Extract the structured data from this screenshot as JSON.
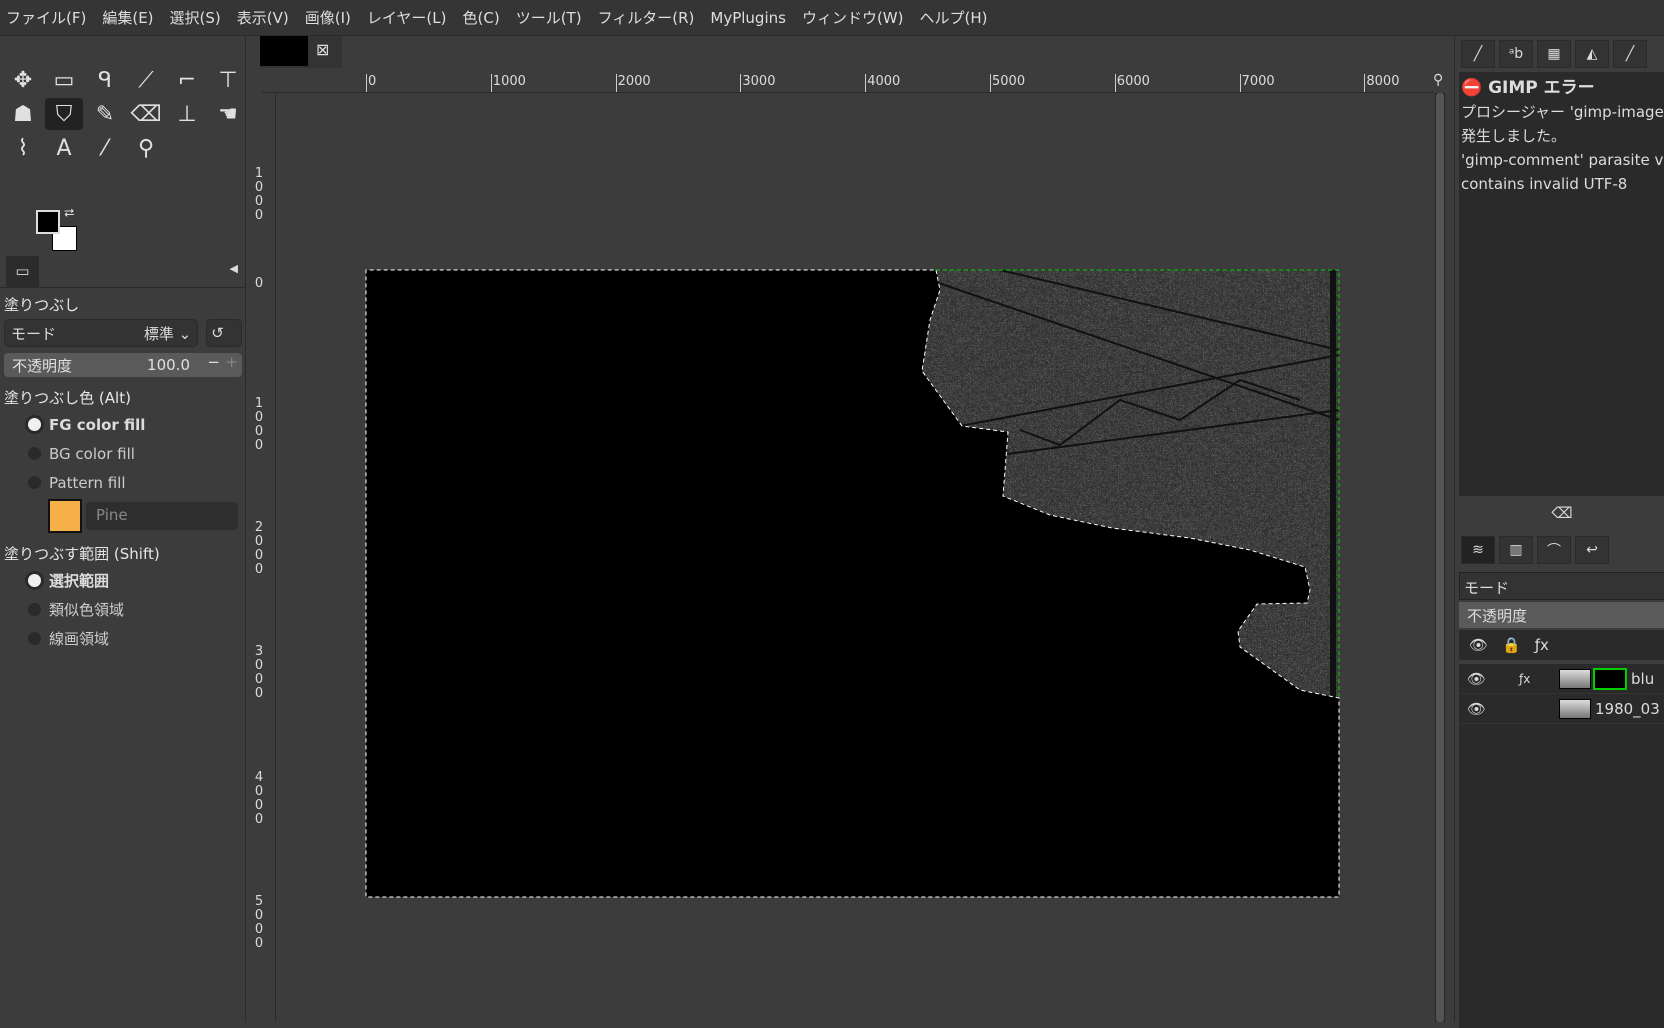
{
  "menu": [
    "ファイル(F)",
    "編集(E)",
    "選択(S)",
    "表示(V)",
    "画像(I)",
    "レイヤー(L)",
    "色(C)",
    "ツール(T)",
    "フィルター(R)",
    "MyPlugins",
    "ウィンドウ(W)",
    "ヘルプ(H)"
  ],
  "tools": [
    {
      "name": "move-tool-icon",
      "glyph": "✥"
    },
    {
      "name": "rect-select-icon",
      "glyph": "▭"
    },
    {
      "name": "lasso-icon",
      "glyph": "ᑫ"
    },
    {
      "name": "fuzzy-select-icon",
      "glyph": "⟋"
    },
    {
      "name": "crop-icon",
      "glyph": "⌐"
    },
    {
      "name": "transform-icon",
      "glyph": "⊤"
    },
    {
      "name": "warp-icon",
      "glyph": "☗"
    },
    {
      "name": "bucket-fill-icon",
      "glyph": "⛉",
      "active": true
    },
    {
      "name": "paintbrush-icon",
      "glyph": "✎"
    },
    {
      "name": "eraser-icon",
      "glyph": "⌫"
    },
    {
      "name": "clone-icon",
      "glyph": "⊥"
    },
    {
      "name": "smudge-icon",
      "glyph": "☚"
    },
    {
      "name": "path-icon",
      "glyph": "⌇"
    },
    {
      "name": "text-icon",
      "glyph": "A"
    },
    {
      "name": "color-picker-icon",
      "glyph": "⁄"
    },
    {
      "name": "zoom-icon",
      "glyph": "⚲"
    }
  ],
  "colors": {
    "fg": "#000000",
    "bg": "#ffffff",
    "pattern": "#f5b04a",
    "selection_green": "#00cc00"
  },
  "options": {
    "title": "塗りつぶし",
    "mode_label": "モード",
    "mode_value": "標準",
    "opacity_label": "不透明度",
    "opacity_value": "100.0",
    "fill_type_label": "塗りつぶし色 (Alt)",
    "fill_types": [
      {
        "label": "FG color fill",
        "selected": true
      },
      {
        "label": "BG color fill",
        "selected": false
      },
      {
        "label": "Pattern fill",
        "selected": false
      }
    ],
    "pattern_name": "Pine",
    "area_label": "塗りつぶす範囲 (Shift)",
    "areas": [
      {
        "label": "選択範囲",
        "selected": true
      },
      {
        "label": "類似色領域",
        "selected": false
      },
      {
        "label": "線画領域",
        "selected": false
      }
    ]
  },
  "ruler": {
    "h": [
      "0",
      "1000",
      "2000",
      "3000",
      "4000",
      "5000",
      "6000",
      "7000",
      "8000"
    ],
    "v": [
      "1000",
      "0",
      "1000",
      "2000",
      "3000",
      "4000",
      "5000"
    ]
  },
  "error": {
    "title": "GIMP エラー",
    "lines": [
      "プロシージャー 'gimp-image-at",
      "発生しました。",
      "'gimp-comment' parasite va",
      "contains invalid UTF-8"
    ]
  },
  "layers": {
    "mode_label": "モード",
    "opacity_label": "不透明度",
    "items": [
      {
        "name": "blu",
        "fx": true
      },
      {
        "name": "1980_03",
        "fx": false
      }
    ]
  }
}
